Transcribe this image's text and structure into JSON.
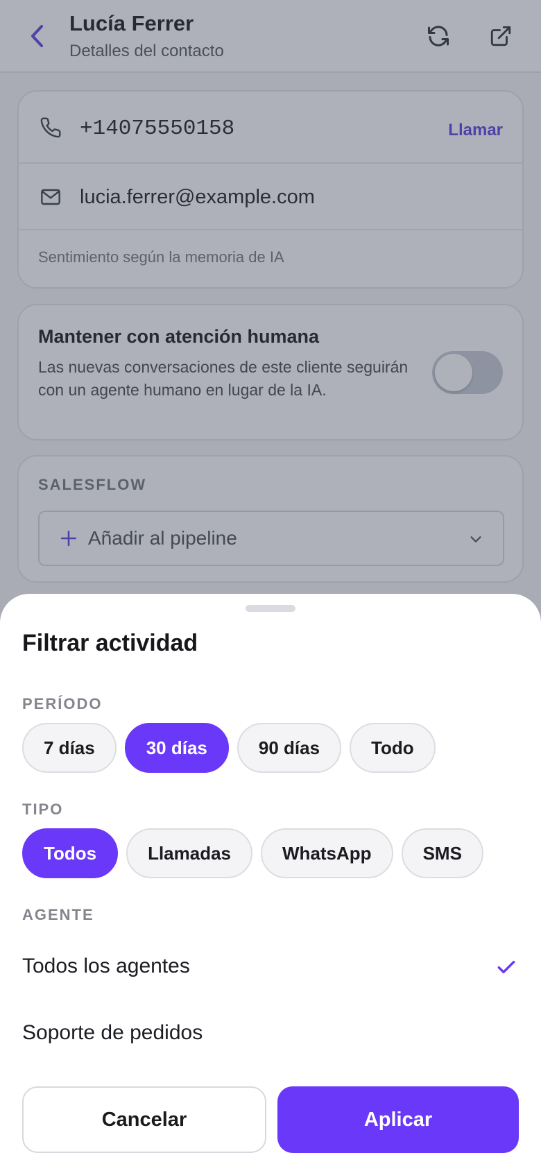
{
  "header": {
    "name": "Lucía Ferrer",
    "subtitle": "Detalles del contacto",
    "icons": [
      "back-chevron-icon",
      "refresh-icon",
      "external-link-icon"
    ]
  },
  "contact": {
    "phone": "+14075550158",
    "call_label": "Llamar",
    "email": "lucia.ferrer@example.com",
    "sentiment_hint": "Sentimiento según la memoria de IA"
  },
  "human_handoff": {
    "title": "Mantener con atención humana",
    "description": "Las nuevas conversaciones de este cliente seguirán con un agente humano en lugar de la IA.",
    "enabled": false
  },
  "salesflow": {
    "label": "SALESFLOW",
    "pipeline_placeholder": "Añadir al pipeline"
  },
  "sheet": {
    "title": "Filtrar actividad",
    "period": {
      "label": "PERÍODO",
      "options": [
        "7 días",
        "30 días",
        "90 días",
        "Todo"
      ],
      "selected": "30 días"
    },
    "type": {
      "label": "TIPO",
      "options": [
        "Todos",
        "Llamadas",
        "WhatsApp",
        "SMS"
      ],
      "selected": "Todos"
    },
    "agent": {
      "label": "AGENTE",
      "options": [
        "Todos los agentes",
        "Soporte de pedidos"
      ],
      "selected": "Todos los agentes"
    },
    "cancel_label": "Cancelar",
    "apply_label": "Aplicar"
  },
  "colors": {
    "accent": "#6a38f8",
    "link": "#5b3fe0",
    "scrim": "#3e4458"
  }
}
